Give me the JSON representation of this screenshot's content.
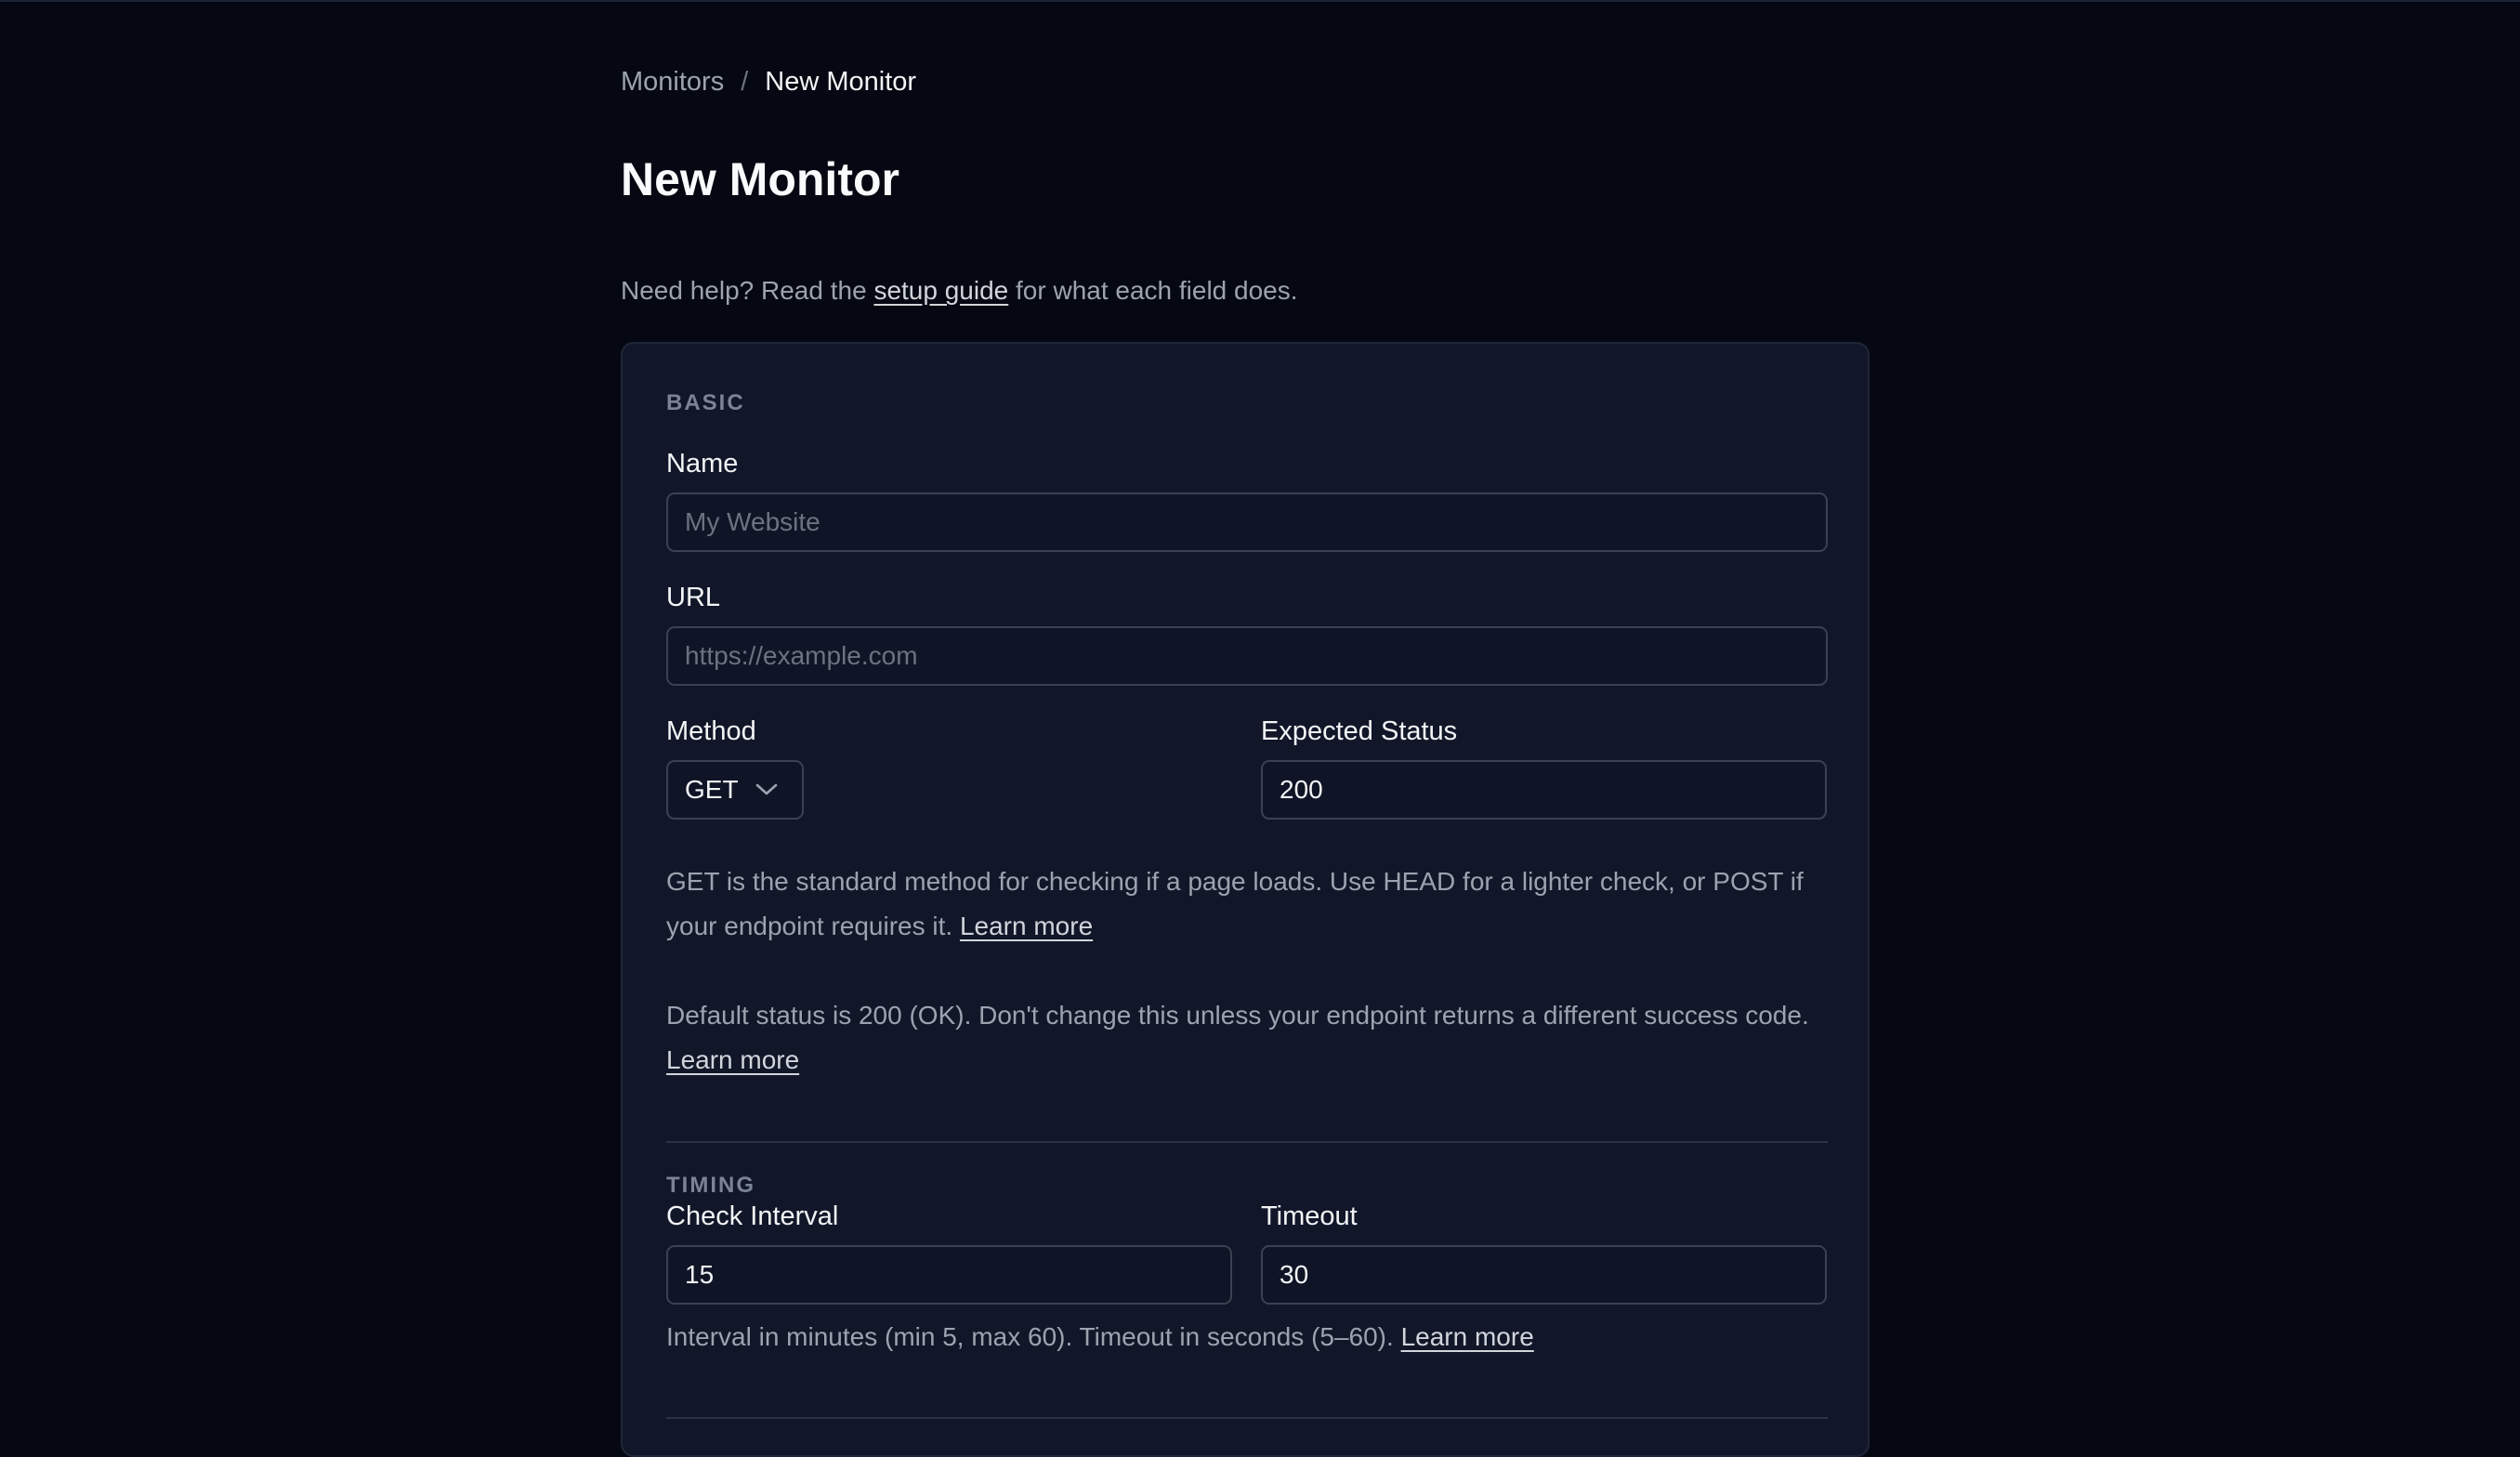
{
  "breadcrumb": {
    "parent": "Monitors",
    "separator": "/",
    "current": "New Monitor"
  },
  "page": {
    "title": "New Monitor"
  },
  "help": {
    "prefix": "Need help? Read the",
    "link": "setup guide",
    "suffix": "for what each field does."
  },
  "sections": {
    "basic": {
      "label": "BASIC",
      "name_label": "Name",
      "name_placeholder": "My Website",
      "name_value": "",
      "url_label": "URL",
      "url_placeholder": "https://example.com",
      "url_value": "",
      "method_label": "Method",
      "method_value": "GET",
      "expected_status_label": "Expected Status",
      "expected_status_value": "200",
      "method_hint": "GET is the standard method for checking if a page loads. Use HEAD for a lighter check, or POST if your endpoint requires it.",
      "method_hint_link": "Learn more",
      "status_hint": "Default status is 200 (OK). Don't change this unless your endpoint returns a different success code.",
      "status_hint_link": "Learn more"
    },
    "timing": {
      "label": "TIMING",
      "interval_label": "Check Interval",
      "interval_value": "15",
      "timeout_label": "Timeout",
      "timeout_value": "30",
      "hint": "Interval in minutes (min 5, max 60). Timeout in seconds (5–60).",
      "hint_link": "Learn more"
    }
  },
  "icons": {
    "method_dropdown": "chevron-down-icon"
  },
  "colors": {
    "background": "#050812",
    "card": "#111729",
    "input_border": "#3a4252"
  }
}
